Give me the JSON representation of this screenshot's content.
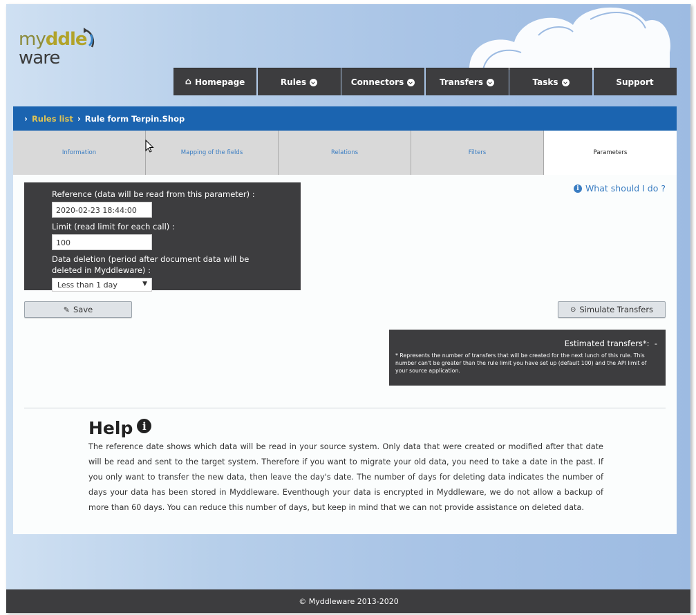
{
  "logo": {
    "line1_prefix": "my",
    "line1_bold": "ddle",
    "line2": "ware"
  },
  "nav": {
    "homepage": "Homepage",
    "rules": "Rules",
    "connectors": "Connectors",
    "transfers": "Transfers",
    "tasks": "Tasks",
    "support": "Support"
  },
  "breadcrumb": {
    "link": "Rules list",
    "current": "Rule form Terpin.Shop"
  },
  "tabs": [
    "Information",
    "Mapping of the fields",
    "Relations",
    "Filters",
    "Parameters"
  ],
  "params": {
    "reference_label": "Reference (data will be read from this parameter) :",
    "reference_value": "2020-02-23 18:44:00",
    "limit_label": "Limit (read limit for each call) :",
    "limit_value": "100",
    "deletion_label": "Data deletion (period after document data will be deleted in Myddleware) :",
    "deletion_value": "Less than 1 day"
  },
  "help_link": "What should I do ?",
  "buttons": {
    "save": "Save",
    "simulate": "Simulate Transfers"
  },
  "estimate": {
    "title": "Estimated transfers*:",
    "value": "-",
    "note": "* Represents the number of transfers that will be created for the next lunch of this rule. This number can't be greater than the rule limit you have set up (default 100) and the API limit of your source application."
  },
  "help": {
    "title": "Help",
    "text": "The reference date shows which data will be read in your source system. Only data that were created or modified after that date will be read and sent to the target system. Therefore if you want to migrate your old data, you need to take a date in the past. If you only want to transfer the new data, then leave the day's date. The number of days for deleting data indicates the number of days your data has been stored in Myddleware. Eventhough your data is encrypted in Myddleware, we do not allow a backup of more than 60 days. You can reduce this number of days, but keep in mind that we can not provide assistance on deleted data."
  },
  "footer": "© Myddleware 2013-2020",
  "colors": {
    "nav_bg": "#3d3d3f",
    "breadcrumb_bg": "#1b64b0",
    "link": "#3a7dc2",
    "crumb_link": "#e0c453"
  }
}
